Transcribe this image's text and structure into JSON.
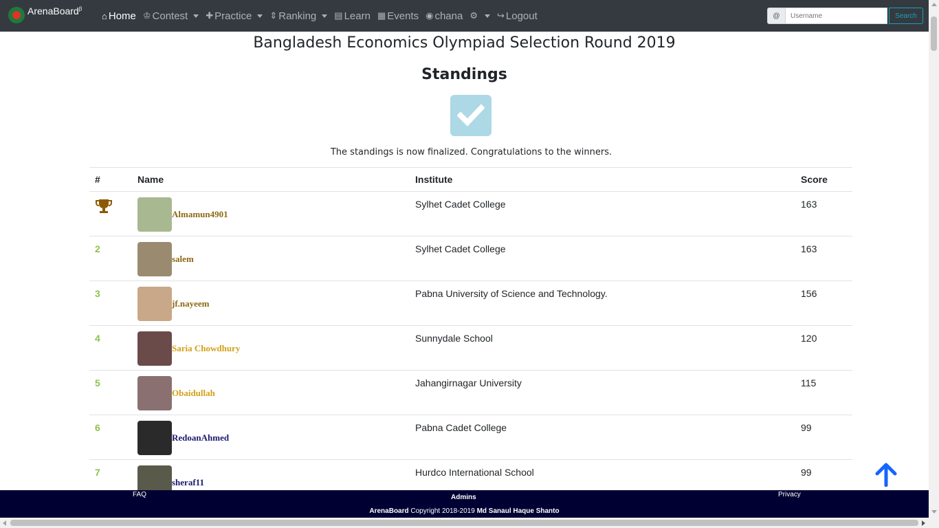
{
  "brand": {
    "name": "ArenaBoard",
    "sup": "β"
  },
  "nav": {
    "home": "Home",
    "contest": "Contest",
    "practice": "Practice",
    "ranking": "Ranking",
    "learn": "Learn",
    "events": "Events",
    "user": "chana",
    "logout": "Logout"
  },
  "search": {
    "prefix": "@",
    "placeholder": "Username",
    "button": "Search"
  },
  "page": {
    "title": "Bangladesh Economics Olympiad Selection Round 2019",
    "subtitle": "Standings",
    "finalized": "The standings is now finalized. Congratulations to the winners."
  },
  "table": {
    "headers": {
      "rank": "#",
      "name": "Name",
      "institute": "Institute",
      "score": "Score"
    },
    "rows": [
      {
        "rank": "",
        "trophy": true,
        "name": "Almamun4901",
        "name_color": "#8b6914",
        "avatar_color": "#a8b890",
        "institute": "Sylhet Cadet College",
        "score": "163"
      },
      {
        "rank": "2",
        "trophy": false,
        "name": "salem",
        "name_color": "#8b6914",
        "avatar_color": "#9a8b70",
        "institute": "Sylhet Cadet College",
        "score": "163"
      },
      {
        "rank": "3",
        "trophy": false,
        "name": "jf.nayeem",
        "name_color": "#8b6914",
        "avatar_color": "#c8a888",
        "institute": "Pabna University of Science and Technology.",
        "score": "156"
      },
      {
        "rank": "4",
        "trophy": false,
        "name": "Saria Chowdhury",
        "name_color": "#d4a017",
        "avatar_color": "#6b4a4a",
        "institute": "Sunnydale School",
        "score": "120"
      },
      {
        "rank": "5",
        "trophy": false,
        "name": "Obaidullah",
        "name_color": "#d4a017",
        "avatar_color": "#8a7070",
        "institute": "Jahangirnagar University",
        "score": "115"
      },
      {
        "rank": "6",
        "trophy": false,
        "name": "RedoanAhmed",
        "name_color": "#1a1a6e",
        "avatar_color": "#2a2a2a",
        "institute": "Pabna Cadet College",
        "score": "99"
      },
      {
        "rank": "7",
        "trophy": false,
        "name": "sheraf11",
        "name_color": "#1a1a6e",
        "avatar_color": "#5a5a4a",
        "institute": "Hurdco International School",
        "score": "99"
      }
    ]
  },
  "footer": {
    "faq": "FAQ",
    "admins": "Admins",
    "privacy": "Privacy",
    "copy_brand": "ArenaBoard",
    "copy_text": " Copyright 2018-2019 ",
    "copy_author": "Md Sanaul Haque Shanto"
  },
  "colors": {
    "navbar": "#343a40",
    "footer": "#000033",
    "rank": "#8bc34a",
    "accent": "#17a2b8",
    "check": "#add8e6",
    "up_arrow": "#1565ff"
  }
}
